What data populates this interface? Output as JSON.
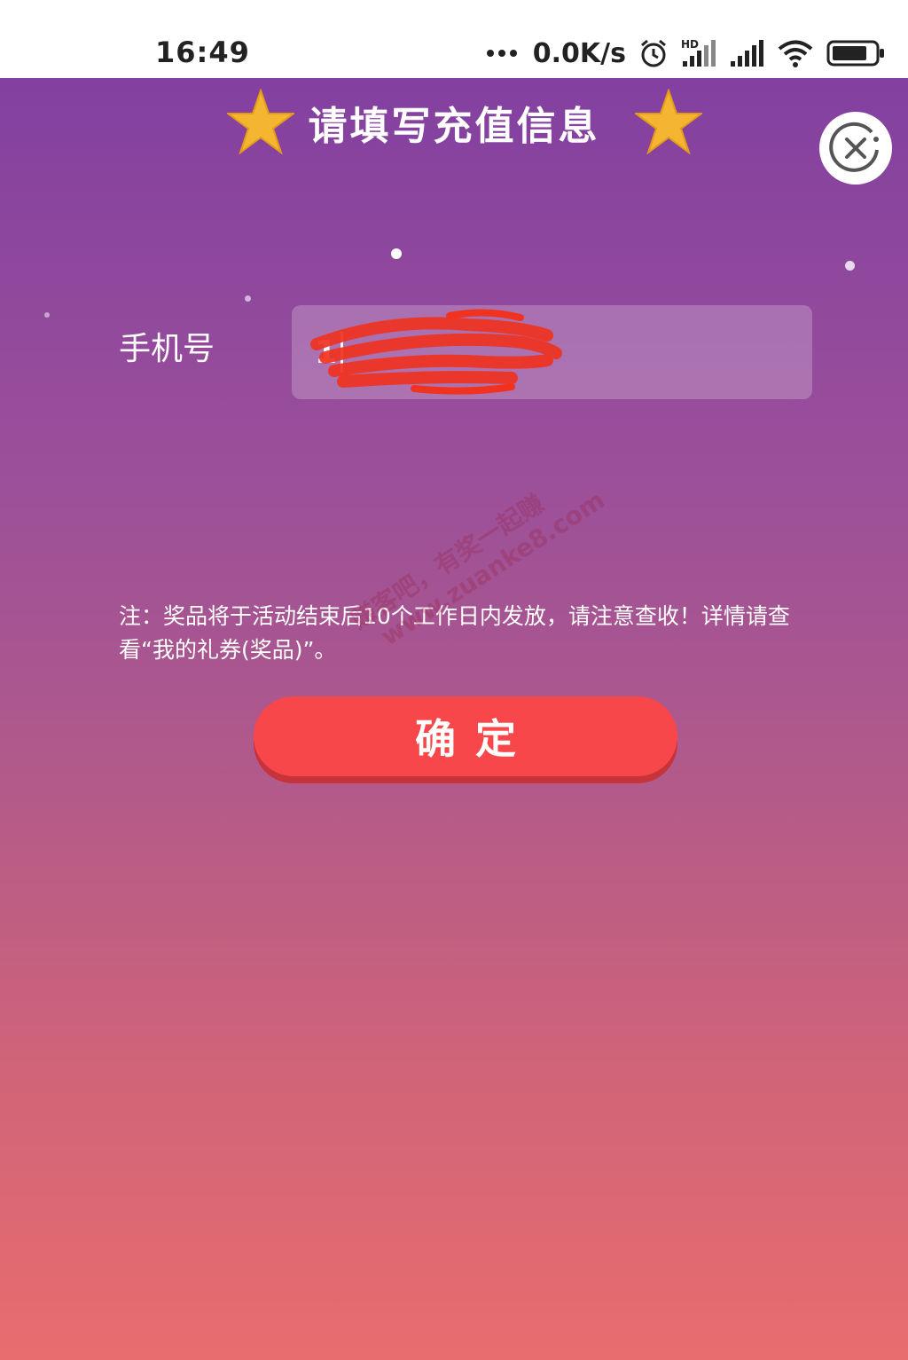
{
  "status_bar": {
    "time": "16:49",
    "net_speed": "0.0K/s",
    "icons": [
      "alarm-icon",
      "hd-signal-icon",
      "signal-icon",
      "wifi-icon",
      "battery-icon"
    ]
  },
  "dialog": {
    "title": "请填写充值信息",
    "close_icon": "close-icon",
    "phone_label": "手机号",
    "phone_value": "1",
    "note": "注：奖品将于活动结束后10个工作日内发放，请注意查收！详情请查看“我的礼券(奖品)”。",
    "confirm_label": "确定"
  },
  "watermark": {
    "line1": "赚客吧，有奖一起赚",
    "line2": "www.zuanke8.com"
  },
  "colors": {
    "gradient_top": "#8340a0",
    "gradient_bottom": "#e86d6e",
    "button": "#f8474a",
    "star": "#f4b630"
  }
}
